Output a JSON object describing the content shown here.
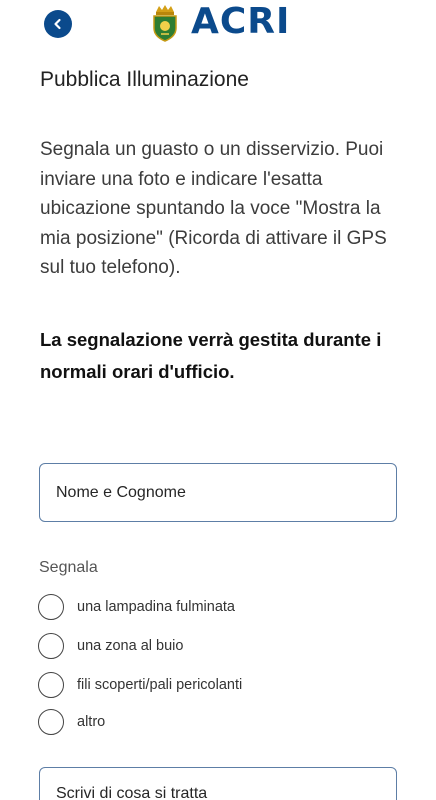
{
  "header": {
    "brand": "ACRI",
    "back_icon": "chevron-left-icon",
    "crest_icon": "municipal-crest-icon",
    "accent_color": "#0b4a8c"
  },
  "page": {
    "title": "Pubblica Illuminazione",
    "intro": "Segnala un guasto o un disservizio. Puoi inviare una foto e indicare l'esatta ubicazione spuntando la voce \"Mostra la mia posizione\" (Ricorda di attivare il GPS sul tuo telefono).",
    "notice": "La segnalazione verrà gestita durante i normali orari d'ufficio."
  },
  "form": {
    "name_placeholder": "Nome e Cognome",
    "segnala_label": "Segnala",
    "options": [
      "una lampadina fulminata",
      "una zona al buio",
      "fili scoperti/pali pericolanti",
      "altro"
    ],
    "description_placeholder": "Scrivi di cosa si tratta"
  }
}
